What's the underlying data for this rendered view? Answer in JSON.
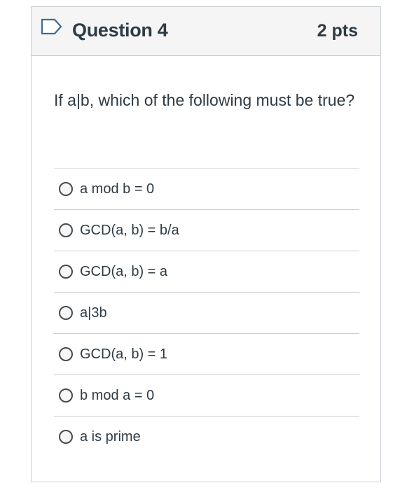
{
  "question": {
    "title": "Question 4",
    "points": "2 pts",
    "text": "If a|b, which of the following must be true?",
    "flag_icon": "flag-outline-icon",
    "accent": "#2d3b45",
    "flag_color": "#3f6b8f"
  },
  "answers": [
    {
      "label": "a mod b = 0"
    },
    {
      "label": "GCD(a, b) = b/a"
    },
    {
      "label": "GCD(a, b) = a"
    },
    {
      "label": "a|3b"
    },
    {
      "label": "GCD(a, b) = 1"
    },
    {
      "label": "b mod a = 0"
    },
    {
      "label": "a is prime"
    }
  ]
}
